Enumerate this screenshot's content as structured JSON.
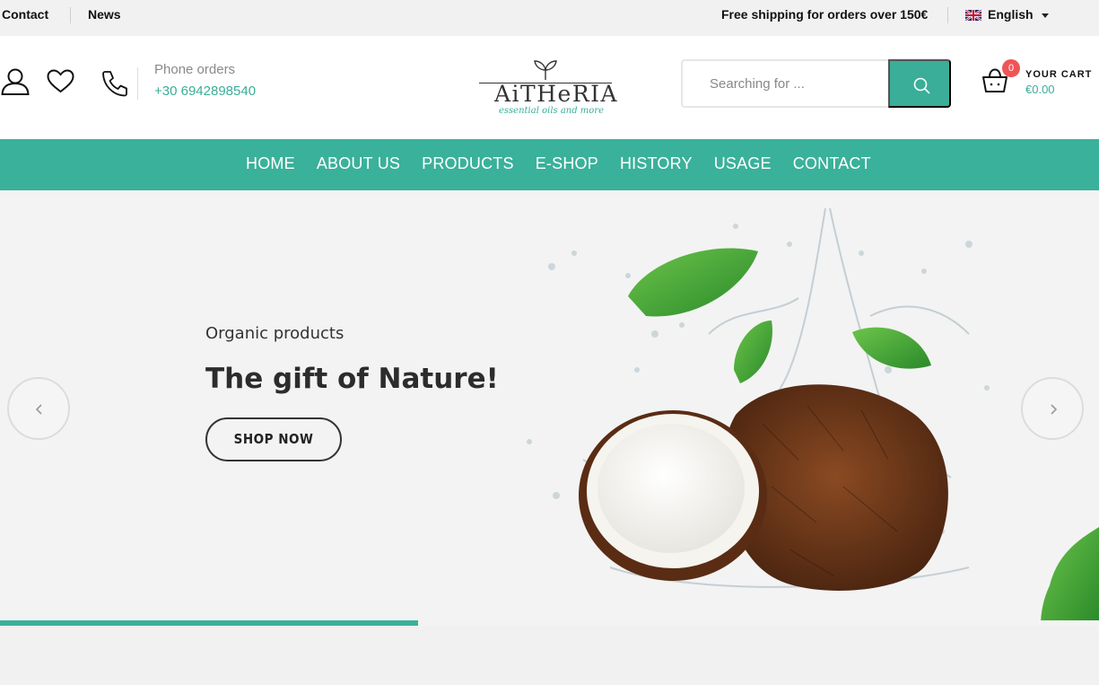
{
  "topbar": {
    "contact": "Contact",
    "news": "News",
    "shipping": "Free shipping for orders over 150€",
    "language": "English"
  },
  "header": {
    "phone_label": "Phone orders",
    "phone_number": "+30 6942898540",
    "logo_text": "AiTHeRIA",
    "logo_tagline": "essential oils and more",
    "search_placeholder": "Searching for ...",
    "cart_label": "YOUR CART",
    "cart_total": "€0.00",
    "cart_count": "0"
  },
  "nav": {
    "items": [
      {
        "label": "HOME"
      },
      {
        "label": "ABOUT US"
      },
      {
        "label": "PRODUCTS"
      },
      {
        "label": "E-SHOP"
      },
      {
        "label": "HISTORY"
      },
      {
        "label": "USAGE"
      },
      {
        "label": "CONTACT"
      }
    ]
  },
  "hero": {
    "subtitle": "Organic products",
    "title": "The gift of Nature!",
    "cta": "SHOP NOW",
    "progress_fraction": 0.38
  },
  "colors": {
    "accent": "#3ab19a",
    "badge": "#f05555"
  }
}
